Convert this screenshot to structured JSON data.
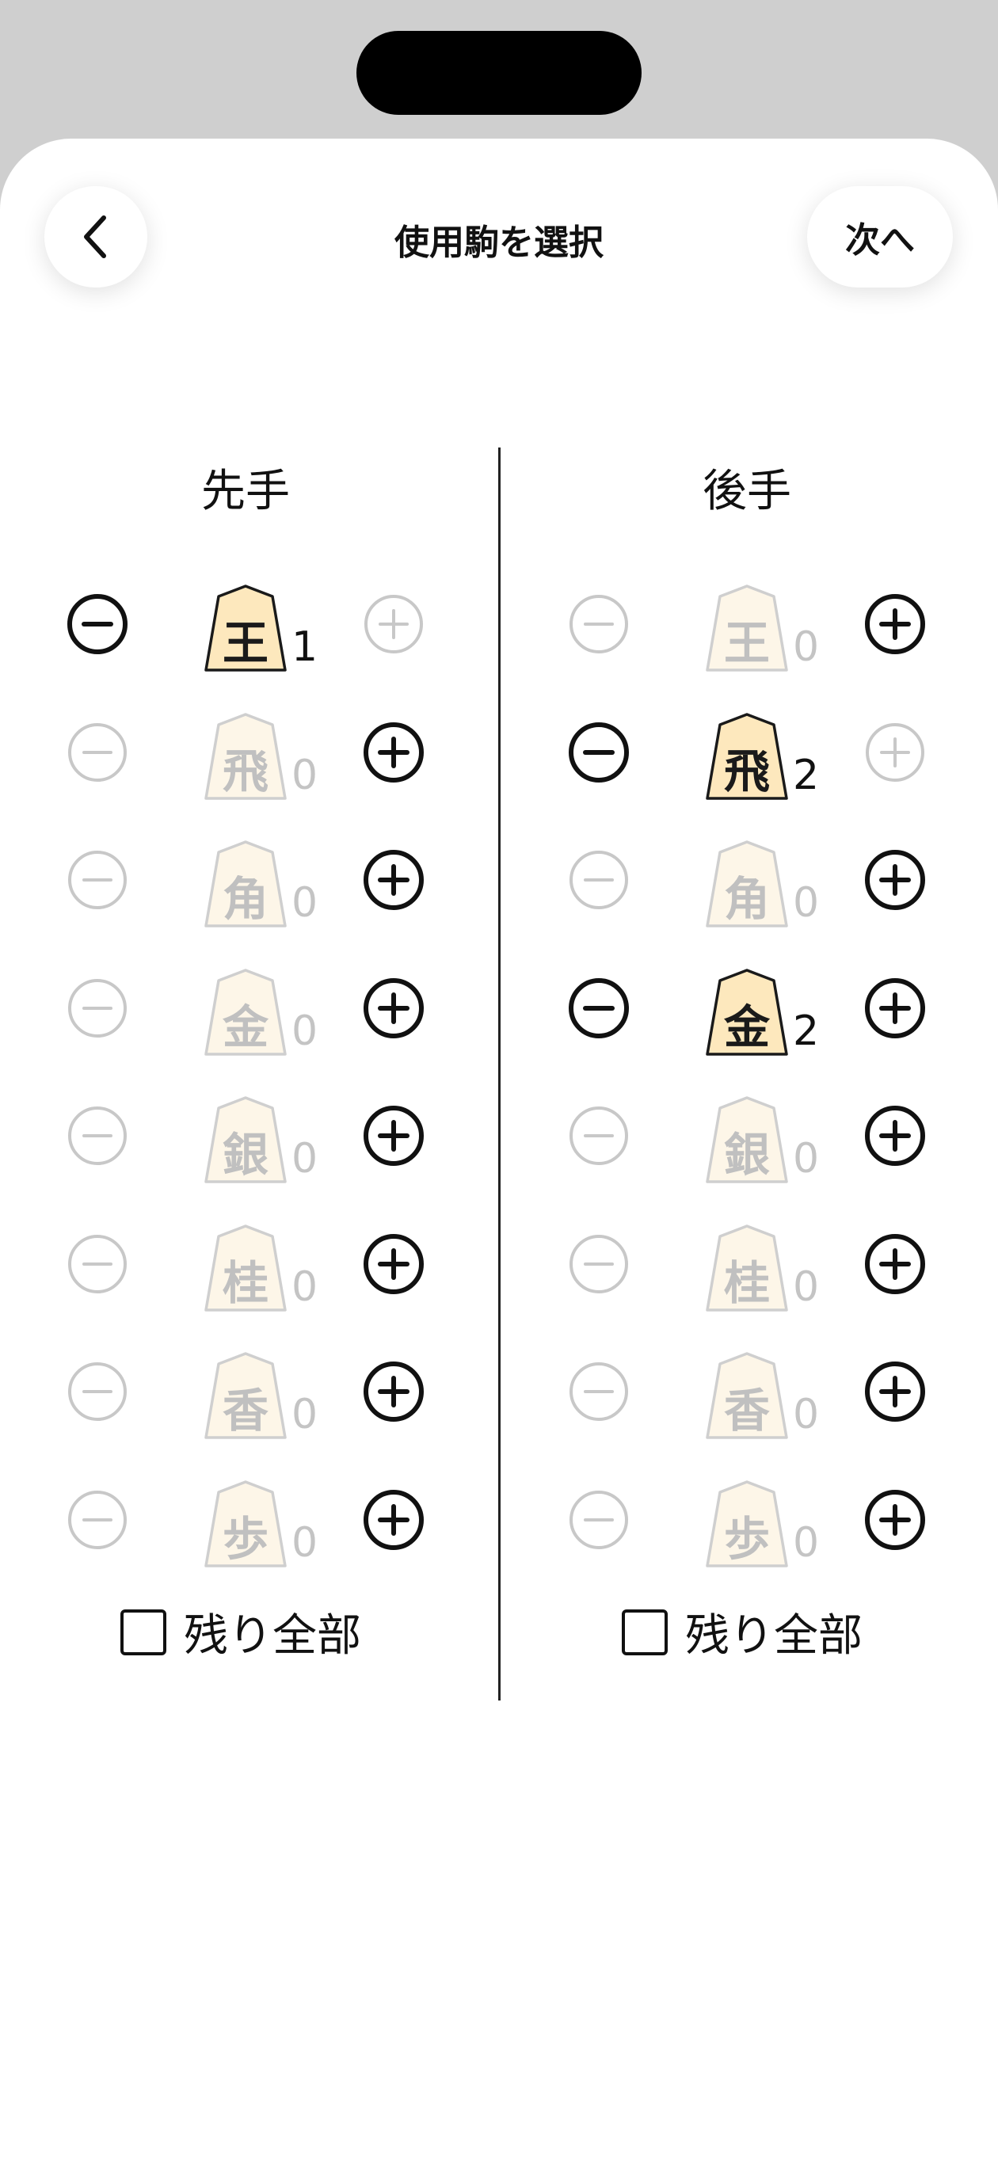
{
  "header": {
    "title": "使用駒を選択",
    "next_label": "次へ",
    "back_icon": "chevron-left-icon"
  },
  "colors": {
    "piece_active_fill": "#fde8bd",
    "piece_inactive_fill": "#fdf6e8",
    "disabled_gray": "#c4c4c4",
    "ink": "#111111"
  },
  "players": [
    {
      "title": "先手",
      "rest_label": "残り全部",
      "rest_checked": false,
      "pieces": [
        {
          "label": "王",
          "count": "1"
        },
        {
          "label": "飛",
          "count": "0"
        },
        {
          "label": "角",
          "count": "0"
        },
        {
          "label": "金",
          "count": "0"
        },
        {
          "label": "銀",
          "count": "0"
        },
        {
          "label": "桂",
          "count": "0"
        },
        {
          "label": "香",
          "count": "0"
        },
        {
          "label": "歩",
          "count": "0"
        }
      ]
    },
    {
      "title": "後手",
      "rest_label": "残り全部",
      "rest_checked": false,
      "pieces": [
        {
          "label": "王",
          "count": "0"
        },
        {
          "label": "飛",
          "count": "2"
        },
        {
          "label": "角",
          "count": "0"
        },
        {
          "label": "金",
          "count": "2"
        },
        {
          "label": "銀",
          "count": "0"
        },
        {
          "label": "桂",
          "count": "0"
        },
        {
          "label": "香",
          "count": "0"
        },
        {
          "label": "歩",
          "count": "0"
        }
      ]
    }
  ]
}
